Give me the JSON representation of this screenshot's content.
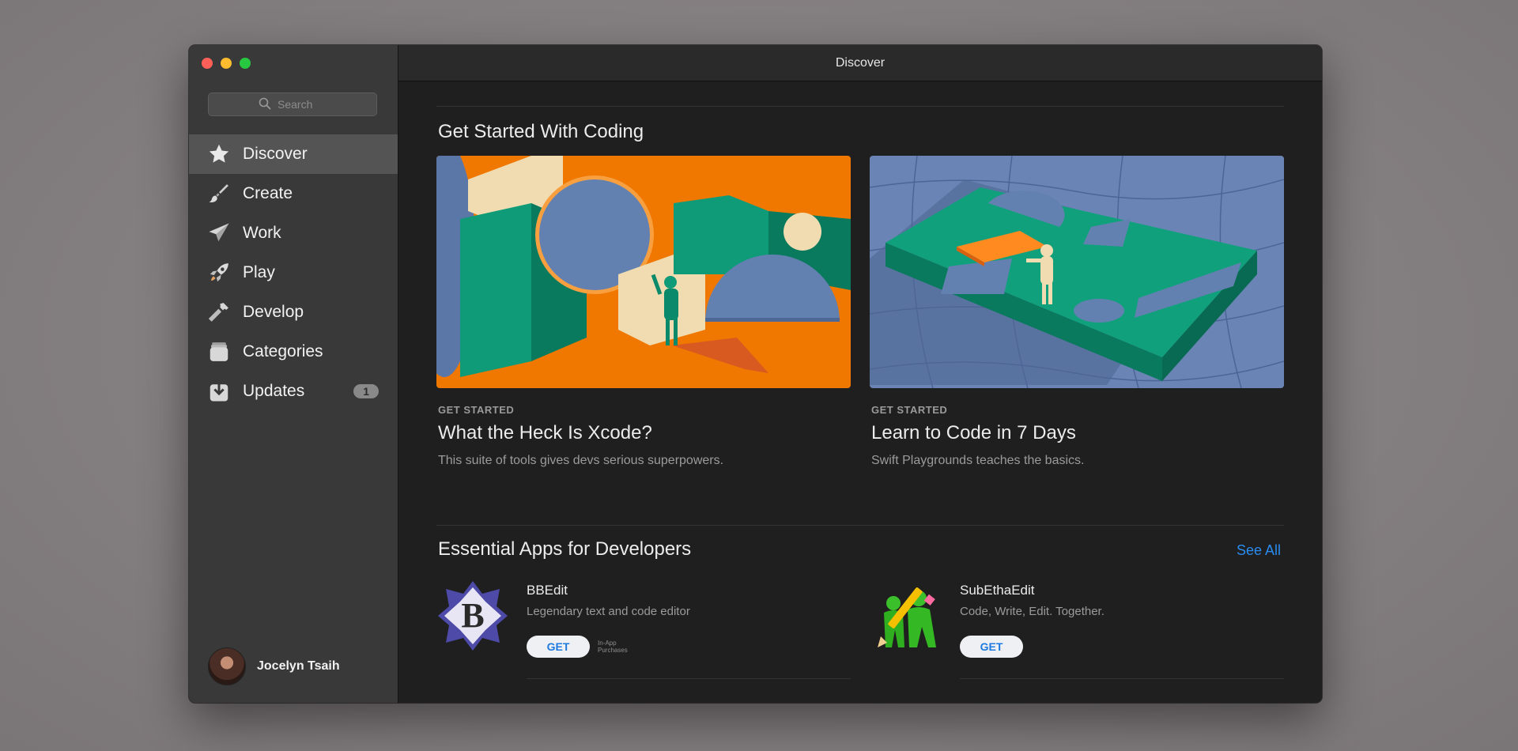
{
  "window": {
    "title": "Discover"
  },
  "sidebar": {
    "search_placeholder": "Search",
    "items": [
      {
        "label": "Discover",
        "icon": "star-icon",
        "active": true
      },
      {
        "label": "Create",
        "icon": "brush-icon"
      },
      {
        "label": "Work",
        "icon": "paper-plane-icon"
      },
      {
        "label": "Play",
        "icon": "rocket-icon"
      },
      {
        "label": "Develop",
        "icon": "hammer-icon"
      },
      {
        "label": "Categories",
        "icon": "stack-icon"
      },
      {
        "label": "Updates",
        "icon": "download-icon",
        "badge": "1"
      }
    ],
    "user": {
      "name": "Jocelyn Tsaih"
    }
  },
  "section1": {
    "title": "Get Started With Coding",
    "cards": [
      {
        "eyebrow": "GET STARTED",
        "title": "What the Heck Is Xcode?",
        "subtitle": "This suite of tools gives devs serious superpowers."
      },
      {
        "eyebrow": "GET STARTED",
        "title": "Learn to Code in 7 Days",
        "subtitle": "Swift Playgrounds teaches the basics."
      }
    ]
  },
  "section2": {
    "title": "Essential Apps for Developers",
    "see_all": "See All",
    "apps": [
      {
        "name": "BBEdit",
        "description": "Legendary text and code editor",
        "button": "GET",
        "note_line1": "In-App",
        "note_line2": "Purchases"
      },
      {
        "name": "SubEthaEdit",
        "description": "Code, Write, Edit. Together.",
        "button": "GET"
      }
    ]
  },
  "colors": {
    "accent": "#2a8cf0",
    "sidebar_bg": "#3a3939",
    "content_bg": "#1f1f1f",
    "orange": "#f07800",
    "teal": "#0f9a78",
    "slate_blue": "#6381b0"
  }
}
